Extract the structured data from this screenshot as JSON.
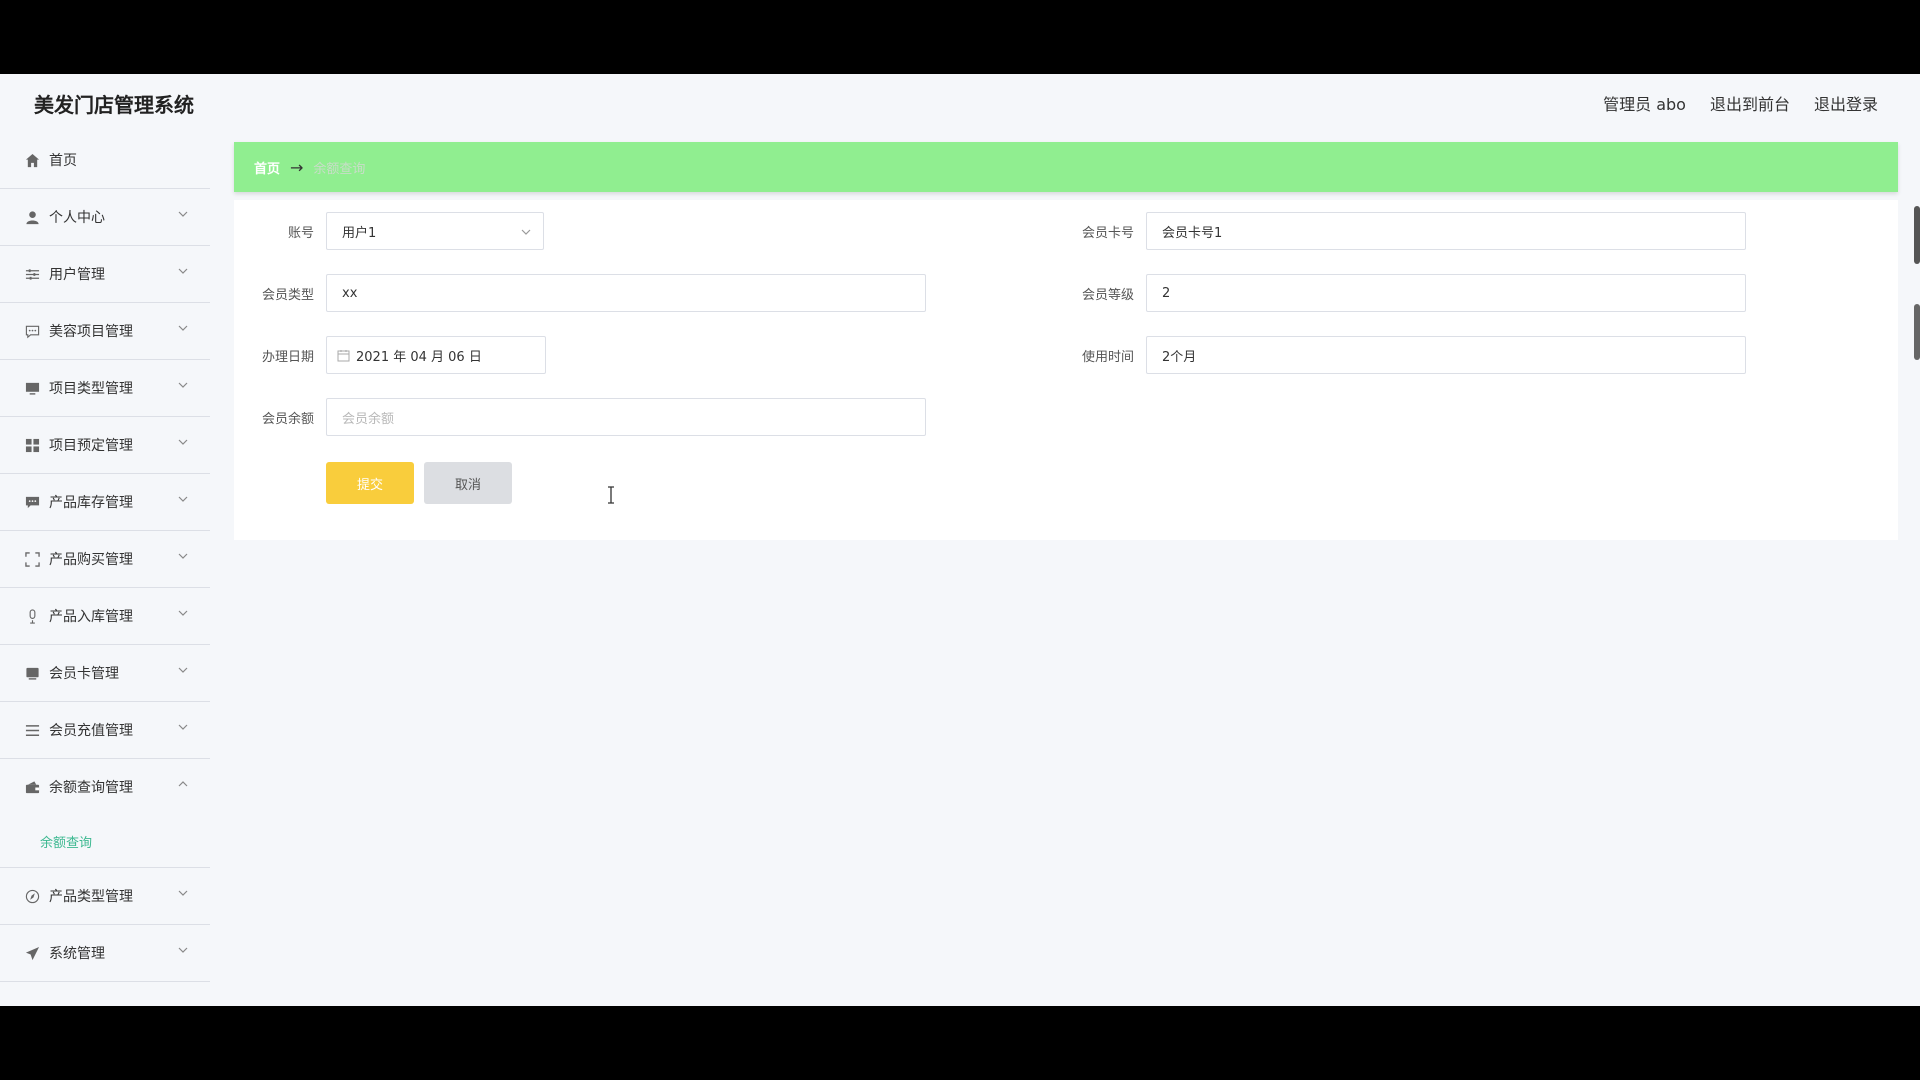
{
  "app": {
    "title": "美发门店管理系统"
  },
  "header": {
    "admin": "管理员 abo",
    "to_front": "退出到前台",
    "logout": "退出登录"
  },
  "sidebar": {
    "items": [
      {
        "label": "首页",
        "icon": "home-icon"
      },
      {
        "label": "个人中心",
        "icon": "user-icon"
      },
      {
        "label": "用户管理",
        "icon": "sliders-icon"
      },
      {
        "label": "美容项目管理",
        "icon": "chat-icon"
      },
      {
        "label": "项目类型管理",
        "icon": "monitor-icon"
      },
      {
        "label": "项目预定管理",
        "icon": "grid-icon"
      },
      {
        "label": "产品库存管理",
        "icon": "message-icon"
      },
      {
        "label": "产品购买管理",
        "icon": "fullscreen-icon"
      },
      {
        "label": "产品入库管理",
        "icon": "microphone-icon"
      },
      {
        "label": "会员卡管理",
        "icon": "card-icon"
      },
      {
        "label": "会员充值管理",
        "icon": "list-icon"
      },
      {
        "label": "余额查询管理",
        "icon": "wallet-icon",
        "sub": "余额查询"
      },
      {
        "label": "产品类型管理",
        "icon": "compass-icon"
      },
      {
        "label": "系统管理",
        "icon": "send-icon"
      }
    ]
  },
  "breadcrumb": {
    "home": "首页",
    "arrow": "→",
    "current": "余额查询"
  },
  "form": {
    "account": {
      "label": "账号",
      "value": "用户1"
    },
    "card_no": {
      "label": "会员卡号",
      "value": "会员卡号1"
    },
    "member_type": {
      "label": "会员类型",
      "value": "xx"
    },
    "member_level": {
      "label": "会员等级",
      "value": "2"
    },
    "date": {
      "label": "办理日期",
      "value": "2021 年 04 月 06 日"
    },
    "usage_time": {
      "label": "使用时间",
      "value": "2个月"
    },
    "balance": {
      "label": "会员余额",
      "placeholder": "会员余额"
    },
    "submit": "提交",
    "cancel": "取消"
  }
}
